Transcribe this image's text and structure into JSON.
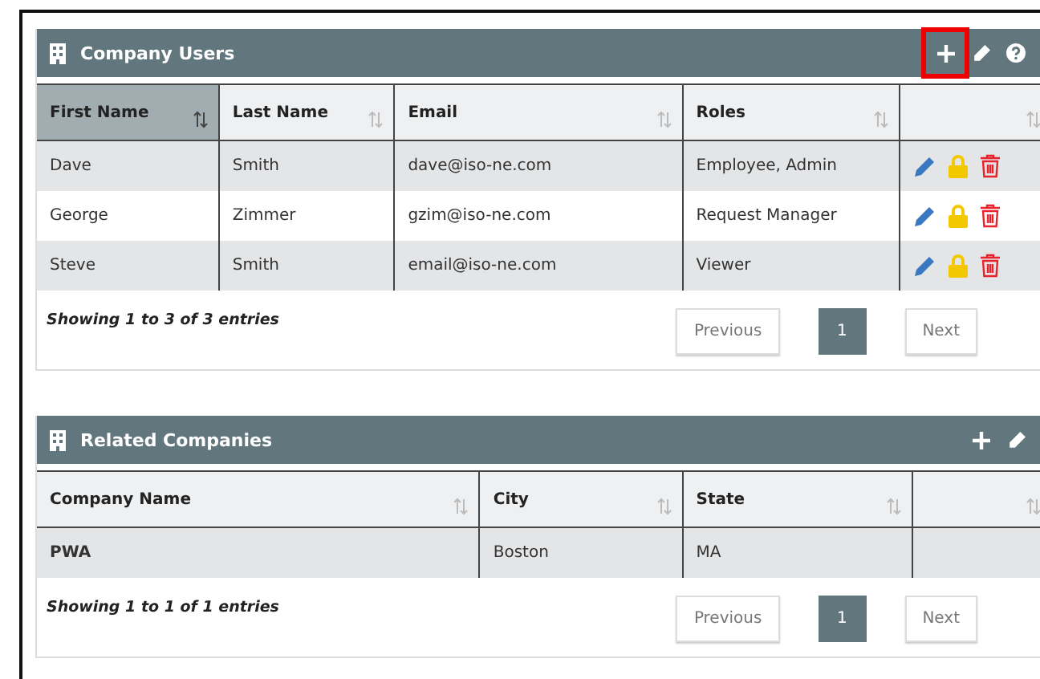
{
  "panels": [
    {
      "title": "Company Users",
      "actions": [
        {
          "kind": "add",
          "highlighted": true
        },
        {
          "kind": "edit",
          "highlighted": false
        },
        {
          "kind": "help",
          "highlighted": false
        }
      ],
      "table": {
        "columns": [
          {
            "label": "First Name",
            "sorted": true
          },
          {
            "label": "Last Name",
            "sorted": false
          },
          {
            "label": "Email",
            "sorted": false
          },
          {
            "label": "Roles",
            "sorted": false
          },
          {
            "sorted": false
          }
        ],
        "rows": [
          {
            "cells": [
              "Dave",
              "Smith",
              "dave@iso-ne.com",
              "Employee, Admin"
            ],
            "row_actions": true
          },
          {
            "cells": [
              "George",
              "Zimmer",
              "gzim@iso-ne.com",
              "Request Manager"
            ],
            "row_actions": true
          },
          {
            "cells": [
              "Steve",
              "Smith",
              "email@iso-ne.com",
              "Viewer"
            ],
            "row_actions": true
          }
        ]
      },
      "info": "Showing 1 to 3 of 3 entries",
      "pager": {
        "previous": "Previous",
        "pages": [
          {
            "label": "1",
            "selected": true
          }
        ],
        "next": "Next"
      }
    },
    {
      "title": "Related Companies",
      "actions": [
        {
          "kind": "add",
          "highlighted": false
        },
        {
          "kind": "edit",
          "highlighted": false
        }
      ],
      "table": {
        "columns": [
          {
            "label": "Company Name",
            "sorted": false
          },
          {
            "label": "City",
            "sorted": false
          },
          {
            "label": "State",
            "sorted": false
          },
          {
            "sorted": false
          }
        ],
        "rows": [
          {
            "cells": [
              "PWA",
              "Boston",
              "MA"
            ],
            "row_actions": false
          }
        ]
      },
      "info": "Showing 1 to 1 of 1 entries",
      "pager": {
        "previous": "Previous",
        "pages": [
          {
            "label": "1",
            "selected": true
          }
        ],
        "next": "Next"
      }
    }
  ]
}
